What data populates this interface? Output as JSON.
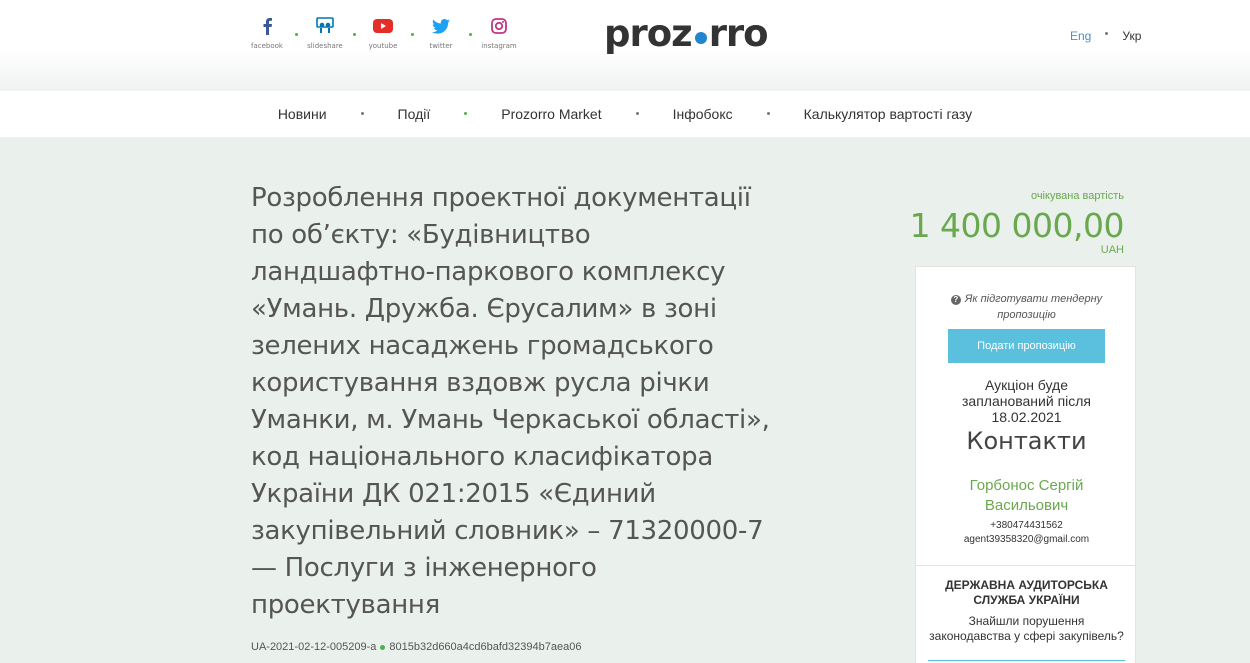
{
  "header": {
    "social": [
      {
        "icon": "facebook-icon",
        "label": "facebook",
        "color": "#3b5998"
      },
      {
        "icon": "slideshare-icon",
        "label": "slideshare",
        "color": "#0077b5"
      },
      {
        "icon": "youtube-icon",
        "label": "youtube",
        "color": "#e52d27"
      },
      {
        "icon": "twitter-icon",
        "label": "twitter",
        "color": "#1da1f2"
      },
      {
        "icon": "instagram-icon",
        "label": "instagram",
        "color": "#c13584"
      }
    ],
    "logo_left": "proz",
    "logo_right": "rro",
    "lang_en": "Eng",
    "lang_uk": "Укр"
  },
  "nav": {
    "items": [
      "Новини",
      "Події",
      "Prozorro Market",
      "Інфобокс",
      "Калькулятор вартості газу"
    ]
  },
  "tender": {
    "title": "Розроблення проектної документації по об’єкту: «Будівництво ландшафтно-паркового комплексу «Умань. Дружба. Єрусалим» в зоні зелених насаджень громадського користування вздовж русла річки Уманки, м. Умань Черкаської області», код національного класифікатора України ДК 021:2015 «Єдиний закупівельний словник» – 71320000-7 — Послуги з інженерного проектування",
    "id": "UA-2021-02-12-005209-a",
    "hash": "8015b32d660a4cd6bafd32394b7aea06"
  },
  "sidebar": {
    "value_label": "очікувана вартість",
    "value_amount": "1 400 000,00",
    "value_currency": "UAH",
    "howto_text": "Як підготувати тендерну пропозицію",
    "submit_button": "Подати пропозицію",
    "auction_text": "Аукціон буде запланований після 18.02.2021",
    "contacts_heading": "Контакти",
    "contact_name": "Горбонос Сергій Васильович",
    "contact_phone": "+380474431562",
    "contact_email": "agent39358320@gmail.com",
    "audit_heading": "ДЕРЖАВНА АУДИТОРСЬКА СЛУЖБА УКРАЇНИ",
    "audit_text": "Знайшли порушення законодавства у сфері закупівель?"
  },
  "colors": {
    "accent_green": "#6aa84f",
    "button_blue": "#5bc0de",
    "logo_dot": "#2185d0"
  }
}
